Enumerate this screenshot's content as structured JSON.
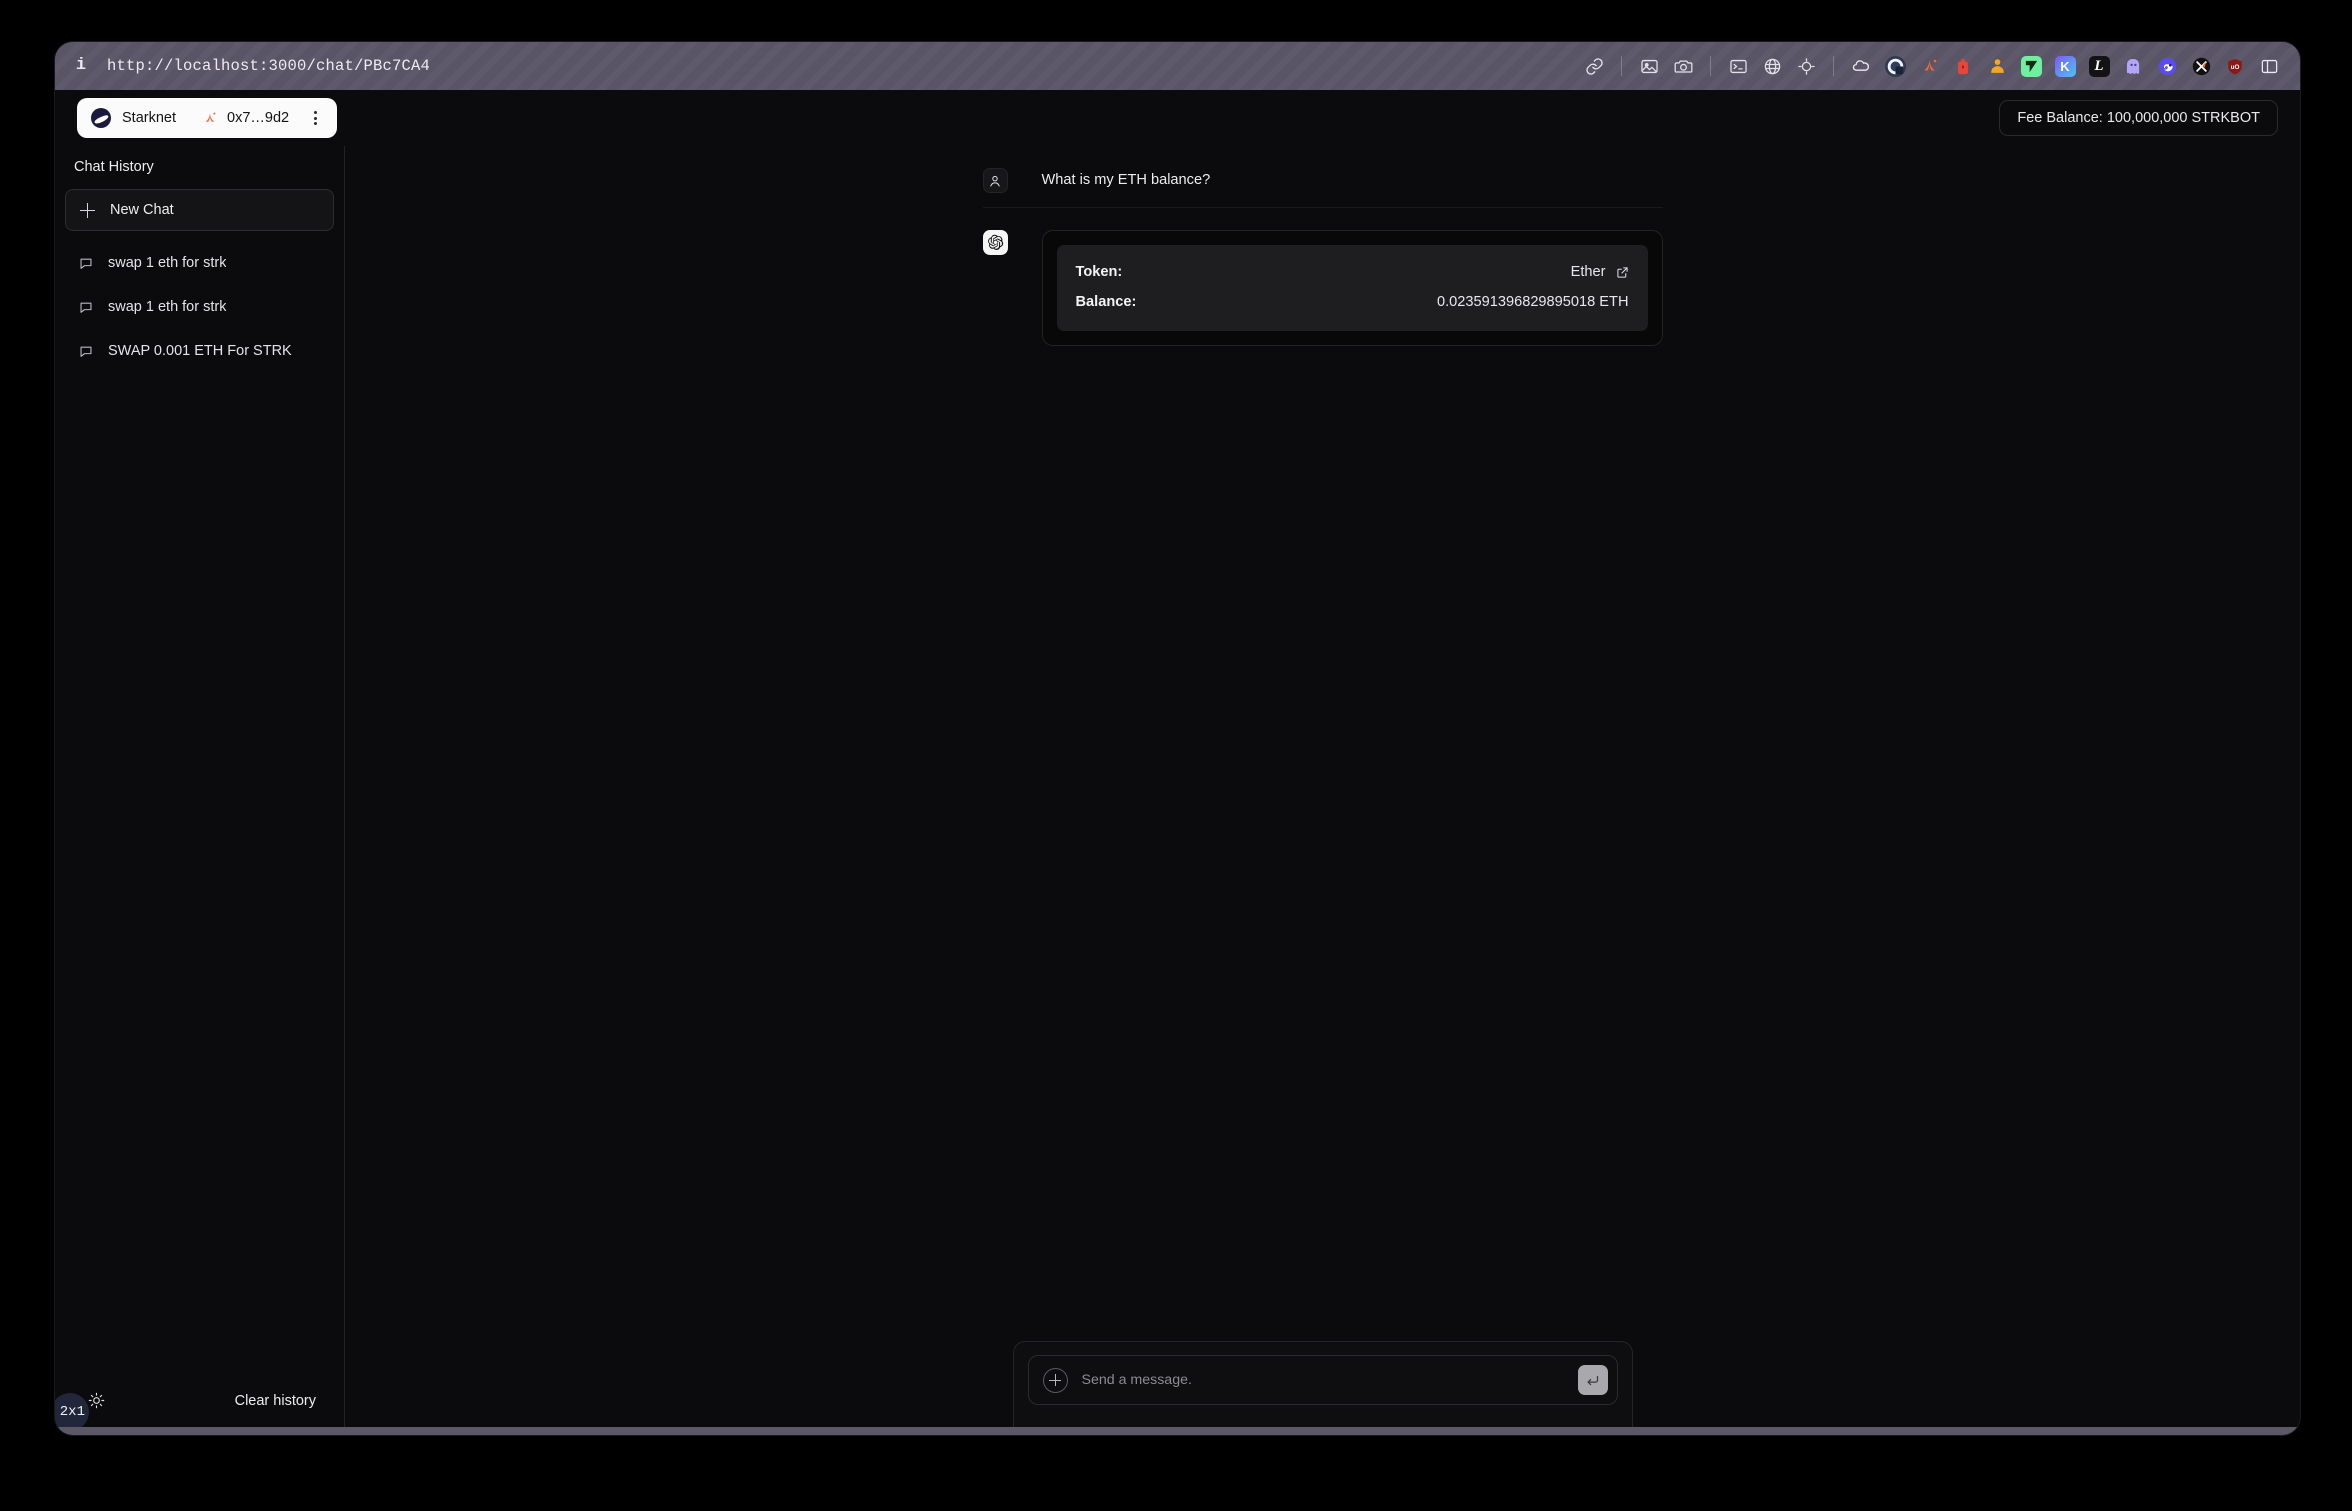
{
  "browser": {
    "url": "http://localhost:3000/chat/PBc7CA4",
    "info_icon": "info-icon",
    "toolbar_icons": [
      {
        "name": "link-icon",
        "kind": "outline"
      },
      {
        "name": "separator",
        "kind": "sep"
      },
      {
        "name": "image-capture-icon",
        "kind": "outline"
      },
      {
        "name": "camera-icon",
        "kind": "outline"
      },
      {
        "name": "separator",
        "kind": "sep"
      },
      {
        "name": "terminal-icon",
        "kind": "outline"
      },
      {
        "name": "globe-icon",
        "kind": "outline"
      },
      {
        "name": "crosshair-icon",
        "kind": "outline"
      },
      {
        "name": "separator",
        "kind": "sep"
      },
      {
        "name": "cloud-extension-icon",
        "kind": "outline"
      },
      {
        "name": "privacy-badger-icon",
        "kind": "chip",
        "color": "#2f3b52",
        "glyph": "Q"
      },
      {
        "name": "argent-wallet-icon",
        "kind": "chip",
        "color": "#ff875b",
        "glyph": "A"
      },
      {
        "name": "braavos-wallet-icon",
        "kind": "chip",
        "color": "#e8453c",
        "glyph": "B"
      },
      {
        "name": "keplr-wallet-icon",
        "kind": "chip",
        "color": "#f5a524",
        "glyph": "K"
      },
      {
        "name": "formatter-extension-icon",
        "kind": "chip",
        "color": "#6ef0a0",
        "glyph": "F"
      },
      {
        "name": "kaspa-extension-icon",
        "kind": "chip",
        "color": "#5b5bf0",
        "glyph": "K"
      },
      {
        "name": "leather-wallet-icon",
        "kind": "chip",
        "color": "#1a1a1a",
        "glyph": "L"
      },
      {
        "name": "ghostery-icon",
        "kind": "chip",
        "color": "#a193f5",
        "glyph": "G"
      },
      {
        "name": "phantom-wallet-icon",
        "kind": "chip",
        "color": "#5b4cf0",
        "glyph": "P"
      },
      {
        "name": "xdefi-wallet-icon",
        "kind": "chip",
        "color": "#111111",
        "glyph": "X"
      },
      {
        "name": "ublock-origin-icon",
        "kind": "chip",
        "color": "#8b1a16",
        "glyph": "uO"
      },
      {
        "name": "sidebar-toggle-icon",
        "kind": "outline"
      }
    ]
  },
  "header": {
    "network_label": "Starknet",
    "account_address": "0x7…9d2",
    "fee_balance": "Fee Balance: 100,000,000 STRKBOT"
  },
  "sidebar": {
    "title": "Chat History",
    "new_chat_label": "New Chat",
    "history": [
      {
        "label": "swap 1 eth for strk"
      },
      {
        "label": "swap 1 eth for strk"
      },
      {
        "label": "SWAP 0.001 ETH For STRK"
      }
    ],
    "clear_history_label": "Clear history",
    "theme_toggle_icon": "sun-icon",
    "overlay_badge": "2x1"
  },
  "chat": {
    "user_message": "What is my ETH balance?",
    "token_card": {
      "rows": [
        {
          "key": "Token:",
          "value": "Ether",
          "has_link": true
        },
        {
          "key": "Balance:",
          "value": "0.023591396829895018 ETH",
          "has_link": false
        }
      ]
    }
  },
  "composer": {
    "placeholder": "Send a message.",
    "value": "",
    "add_icon": "plus-icon",
    "send_icon": "enter-return-icon"
  },
  "colors": {
    "page_bg": "#0b0b0d",
    "chrome_bg": "#5a5566",
    "card_inner": "#1e1e21",
    "accent_white": "#fbfbfb"
  }
}
